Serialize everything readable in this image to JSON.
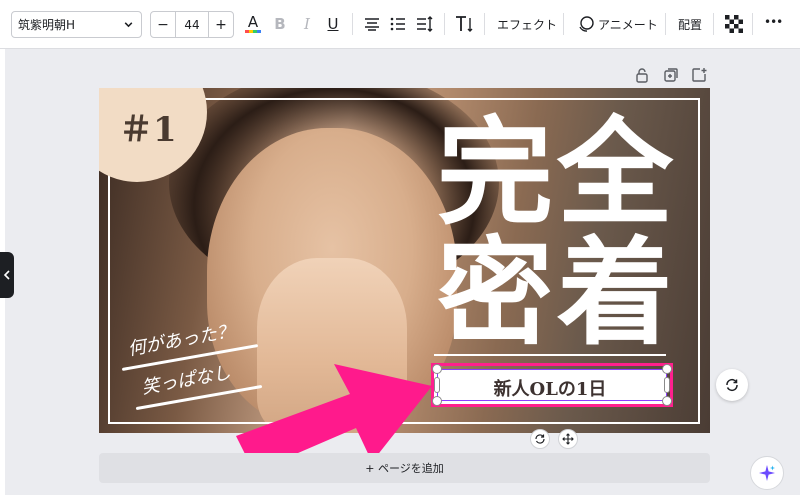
{
  "toolbar": {
    "font_name": "筑紫明朝H",
    "font_size": "44",
    "minus_label": "−",
    "plus_label": "+",
    "effects_label": "エフェクト",
    "animate_label": "アニメート",
    "position_label": "配置",
    "more_label": "•••"
  },
  "canvas": {
    "badge": "＃1",
    "headline_chars": [
      "完",
      "全",
      "密",
      "着"
    ],
    "script_line1": "何があった？",
    "script_line2": "笑っぱなし",
    "subtitle": "新人OLの1日"
  },
  "add_page_label": "+ ページを追加",
  "colors": {
    "selection_pink": "#ff1f8e",
    "selection_purple": "#8b3dff",
    "arrow_pink": "#ff1a8c"
  }
}
